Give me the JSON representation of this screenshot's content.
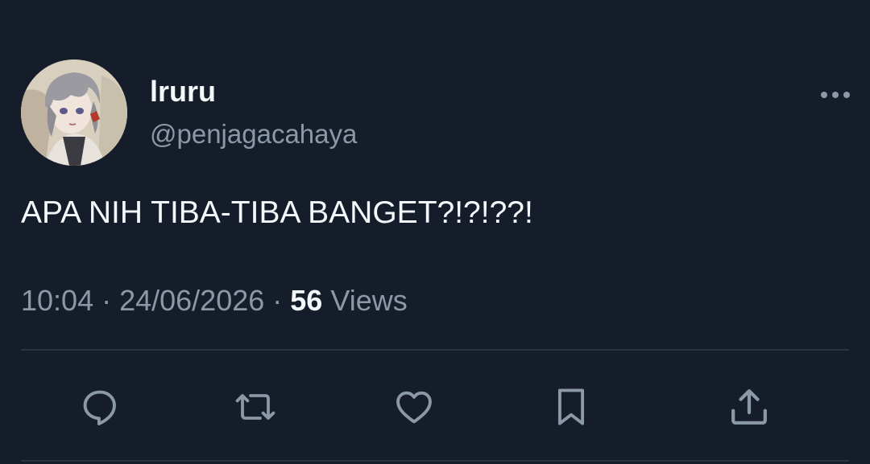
{
  "author": {
    "display_name": "lruru",
    "handle": "@penjagacahaya"
  },
  "tweet": {
    "text": "APA NIH TIBA-TIBA BANGET?!?!??!",
    "time": "10:04",
    "date": "24/06/2026",
    "separator": " · ",
    "views_count": "56",
    "views_label": "Views"
  },
  "icons": {
    "more": "more-options-icon",
    "reply": "reply-icon",
    "retweet": "retweet-icon",
    "like": "heart-icon",
    "bookmark": "bookmark-icon",
    "share": "share-icon"
  },
  "colors": {
    "background": "#151d2b",
    "primary_text": "#f5f8fa",
    "secondary_text": "#8b98a5",
    "divider": "#2a3441"
  }
}
